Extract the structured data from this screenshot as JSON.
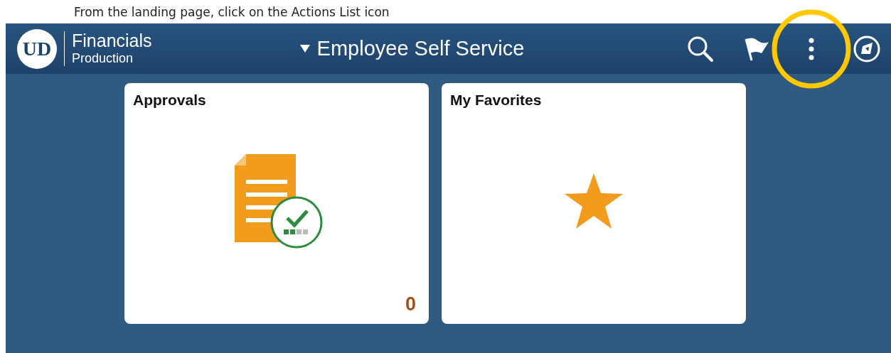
{
  "instruction": "From the landing page, click on the Actions List icon",
  "header": {
    "logo_text": "UD",
    "app_name": "Financials",
    "environment": "Production",
    "homepage_title": "Employee Self Service",
    "actions": [
      {
        "kind": "search",
        "highlighted": false
      },
      {
        "kind": "notifications",
        "highlighted": false
      },
      {
        "kind": "actions",
        "highlighted": true
      },
      {
        "kind": "navigator",
        "highlighted": false
      }
    ]
  },
  "tiles": [
    {
      "title": "Approvals",
      "kind": "approvals",
      "count": "0"
    },
    {
      "title": "My Favorites",
      "kind": "favorites"
    }
  ]
}
